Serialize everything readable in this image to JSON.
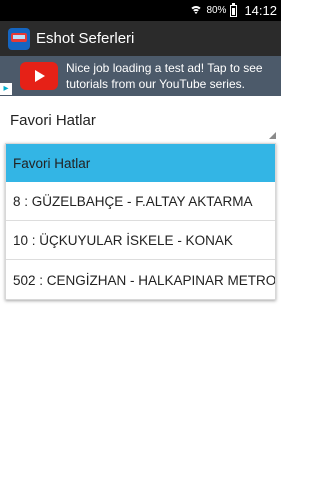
{
  "status_bar": {
    "battery_percent": "80%",
    "time": "14:12"
  },
  "action_bar": {
    "title": "Eshot Seferleri"
  },
  "ad": {
    "text": "Nice job loading a test ad!  Tap to see tutorials from our YouTube series.",
    "badge": "▸"
  },
  "spinner": {
    "selected": "Favori Hatlar"
  },
  "dropdown": {
    "items": [
      "Favori Hatlar",
      "8 : GÜZELBAHÇE - F.ALTAY AKTARMA",
      "10 : ÜÇKUYULAR İSKELE - KONAK",
      "502 : CENGİZHAN - HALKAPINAR METRO"
    ],
    "selected_index": 0
  },
  "colors": {
    "selected_item": "#33b5e5",
    "action_bar": "#2b2b2b",
    "ad_background": "#4c5a6a"
  }
}
